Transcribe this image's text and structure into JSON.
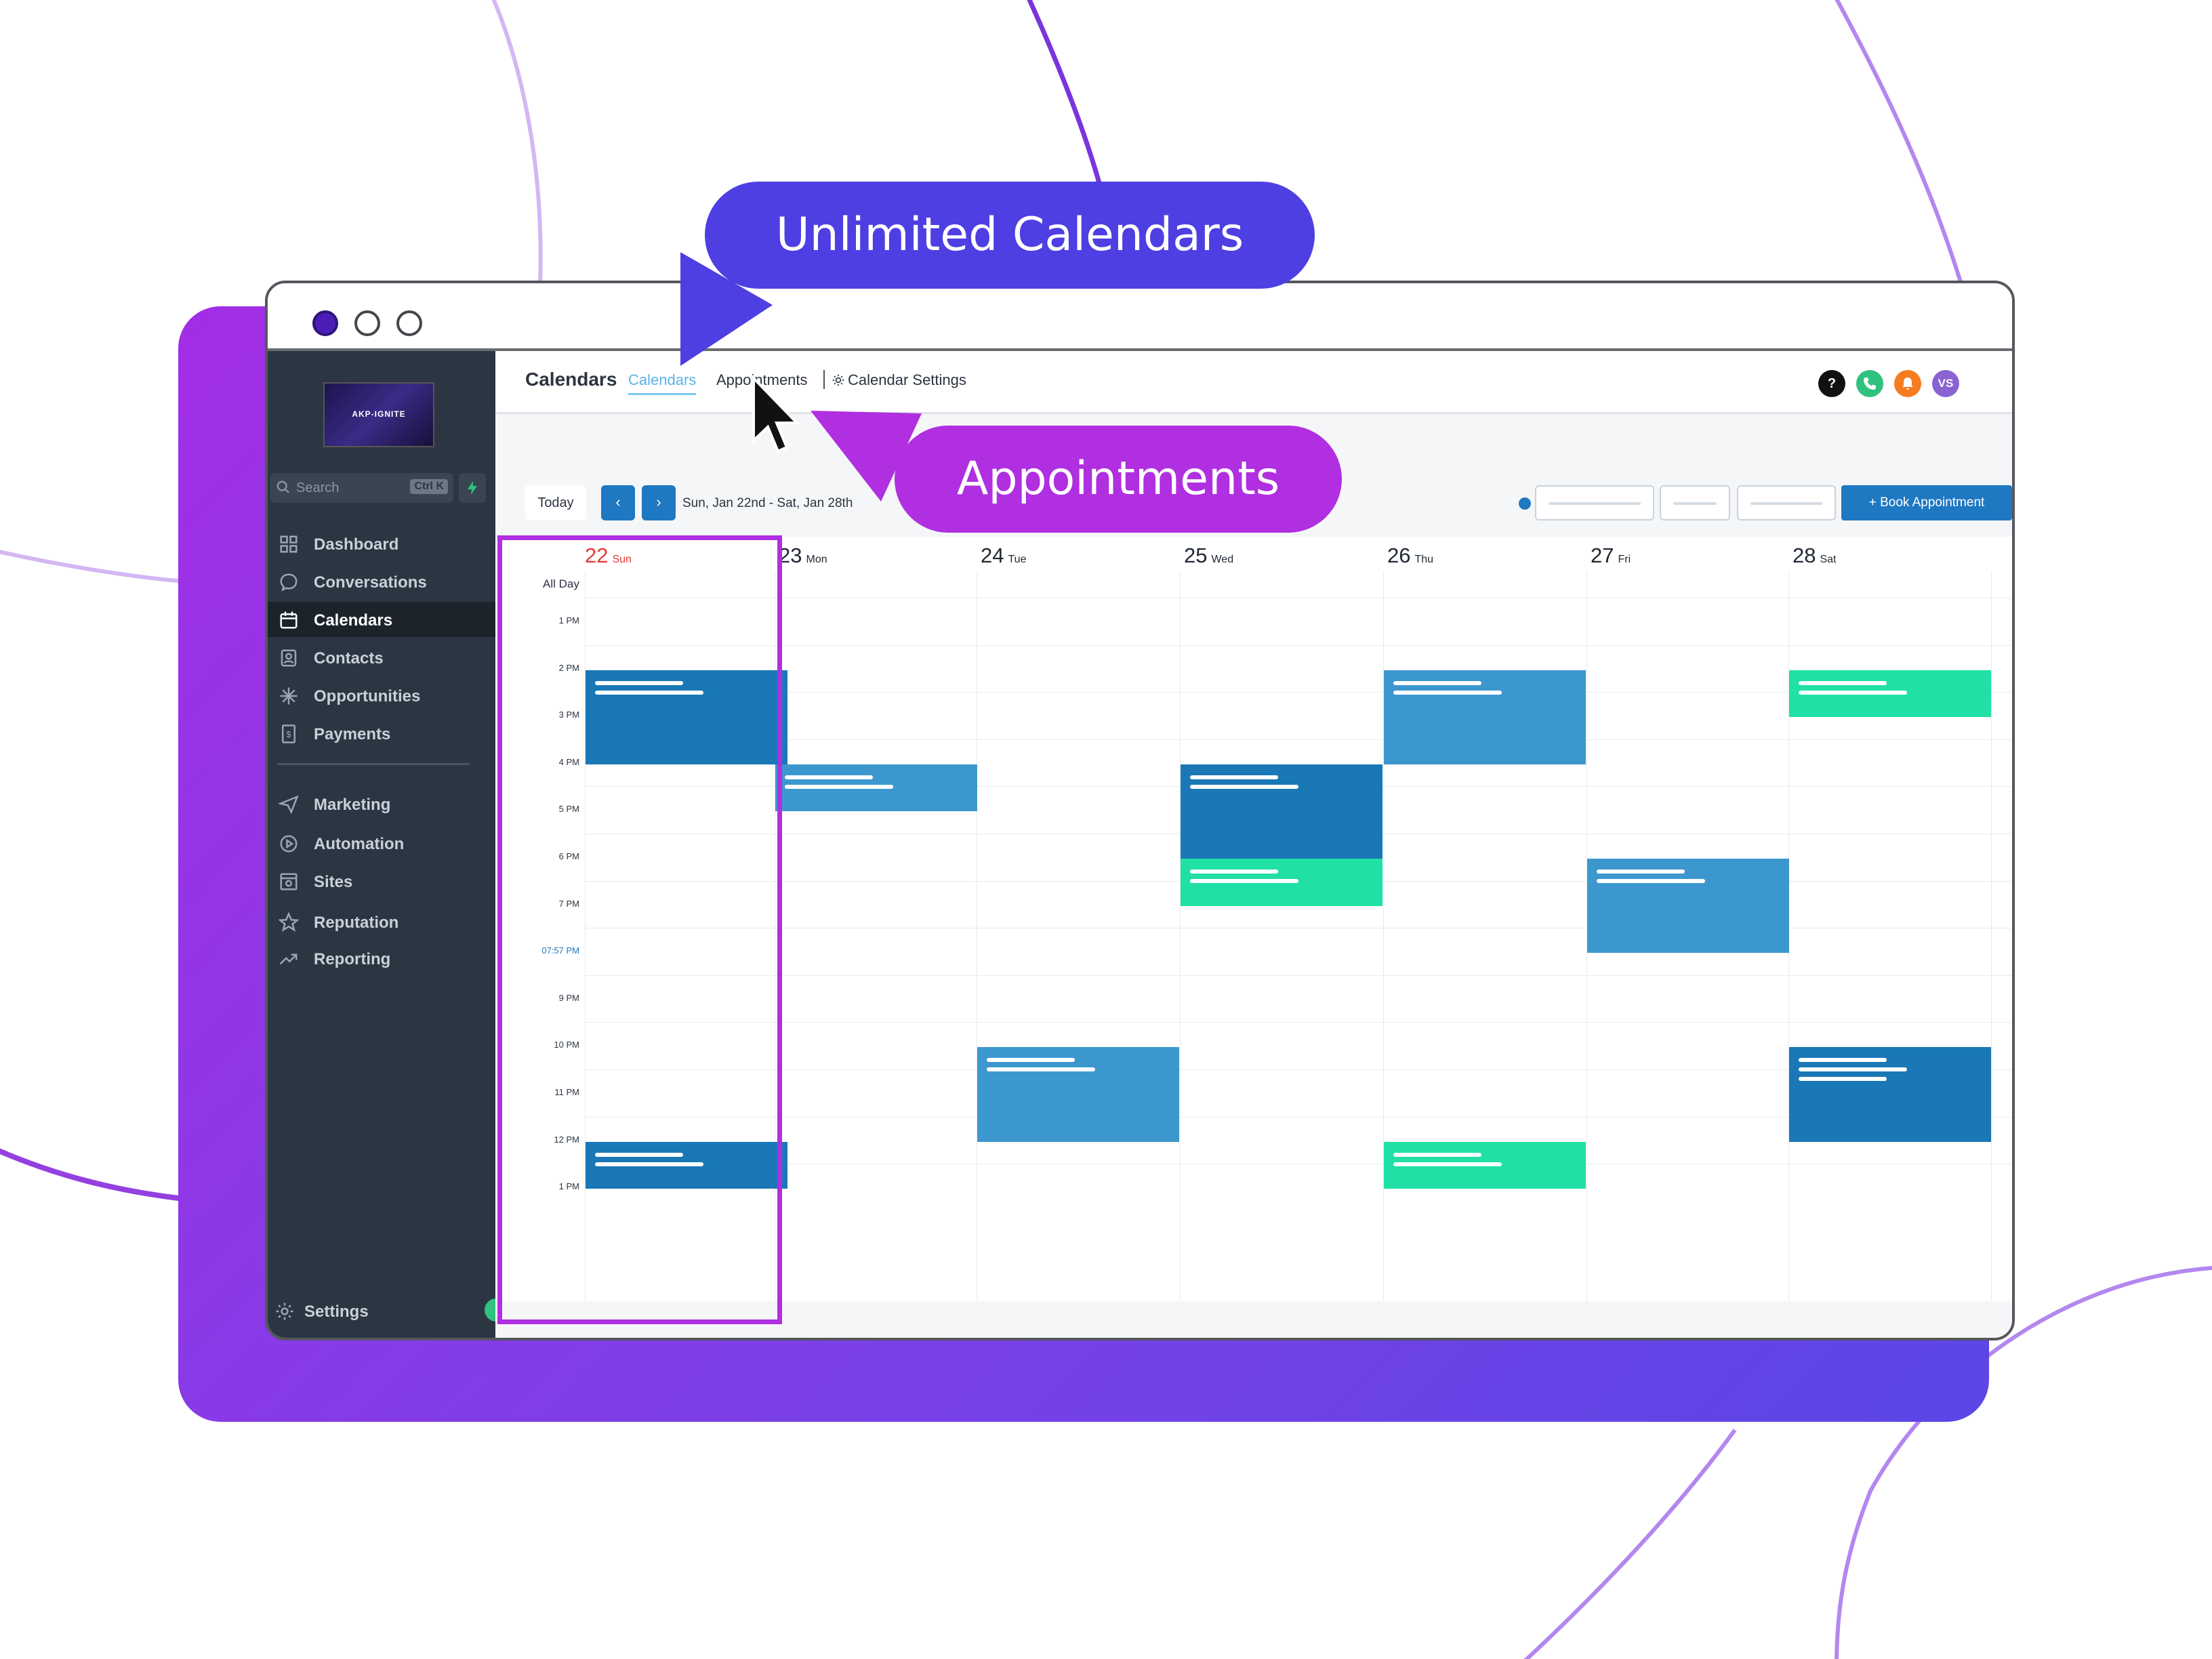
{
  "callouts": {
    "unlimited_calendars": "Unlimited Calendars",
    "appointments": "Appointments"
  },
  "sidebar": {
    "logo_text": "AKP-IGNITE",
    "search_placeholder": "Search",
    "search_shortcut": "Ctrl K",
    "items": [
      {
        "label": "Dashboard",
        "icon": "dashboard-icon"
      },
      {
        "label": "Conversations",
        "icon": "chat-icon"
      },
      {
        "label": "Calendars",
        "icon": "calendar-icon",
        "active": true
      },
      {
        "label": "Contacts",
        "icon": "contacts-icon"
      },
      {
        "label": "Opportunities",
        "icon": "opportunities-icon"
      },
      {
        "label": "Payments",
        "icon": "payments-icon"
      },
      {
        "label": "Marketing",
        "icon": "send-icon"
      },
      {
        "label": "Automation",
        "icon": "automation-icon"
      },
      {
        "label": "Sites",
        "icon": "sites-icon"
      },
      {
        "label": "Reputation",
        "icon": "star-icon"
      },
      {
        "label": "Reporting",
        "icon": "trend-icon"
      }
    ],
    "settings_label": "Settings"
  },
  "header": {
    "title": "Calendars",
    "tabs": {
      "calendars": "Calendars",
      "appointments": "Appointments",
      "settings": "Calendar Settings"
    },
    "icons": {
      "help": "?",
      "avatar": "VS"
    }
  },
  "toolbar": {
    "today": "Today",
    "prev": "‹",
    "next": "›",
    "date_range": "Sun, Jan 22nd - Sat, Jan 28th",
    "book_button": "+ Book Appointment"
  },
  "calendar": {
    "all_day": "All Day",
    "days": [
      {
        "num": "22",
        "name": "Sun",
        "today": true
      },
      {
        "num": "23",
        "name": "Mon"
      },
      {
        "num": "24",
        "name": "Tue"
      },
      {
        "num": "25",
        "name": "Wed"
      },
      {
        "num": "26",
        "name": "Thu"
      },
      {
        "num": "27",
        "name": "Fri"
      },
      {
        "num": "28",
        "name": "Sat"
      }
    ],
    "time_labels": [
      "1 PM",
      "2 PM",
      "3 PM",
      "4 PM",
      "5 PM",
      "6 PM",
      "7 PM",
      "07:57 PM",
      "9 PM",
      "10 PM",
      "11 PM",
      "12 PM",
      "1 PM"
    ],
    "current_time": "07:57 PM",
    "colors": {
      "dark_blue": "#1a78b6",
      "light_blue": "#3d97cf",
      "green": "#20e0a6",
      "today_red": "#e53935",
      "highlight": "#b02fe0"
    },
    "events": [
      {
        "day": "Sun",
        "start": "2 PM",
        "end": "4 PM",
        "color": "dark_blue"
      },
      {
        "day": "Sun",
        "start": "12 PM",
        "end": "1 PM",
        "color": "dark_blue"
      },
      {
        "day": "Mon",
        "start": "4 PM",
        "end": "5 PM",
        "color": "light_blue"
      },
      {
        "day": "Tue",
        "start": "10 PM",
        "end": "12 PM",
        "color": "light_blue"
      },
      {
        "day": "Wed",
        "start": "4 PM",
        "end": "6 PM",
        "color": "dark_blue"
      },
      {
        "day": "Wed",
        "start": "6 PM",
        "end": "7 PM",
        "color": "green"
      },
      {
        "day": "Thu",
        "start": "2 PM",
        "end": "4 PM",
        "color": "light_blue"
      },
      {
        "day": "Thu",
        "start": "12 PM",
        "end": "1 PM",
        "color": "green"
      },
      {
        "day": "Fri",
        "start": "6 PM",
        "end": "8 PM",
        "color": "light_blue"
      },
      {
        "day": "Sat",
        "start": "2 PM",
        "end": "3 PM",
        "color": "green"
      },
      {
        "day": "Sat",
        "start": "10 PM",
        "end": "12 PM",
        "color": "dark_blue"
      }
    ]
  }
}
